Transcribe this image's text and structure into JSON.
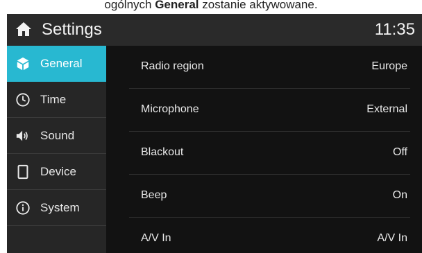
{
  "caption": {
    "prefix": "ogólnych ",
    "bold": "General",
    "suffix": " zostanie aktywowane."
  },
  "header": {
    "title": "Settings",
    "time": "11:35",
    "home_icon": "home-icon"
  },
  "colors": {
    "accent": "#28b8d1",
    "header_bg": "#2a2a2a",
    "sidebar_bg": "#262626",
    "content_bg": "#121212"
  },
  "sidebar": {
    "items": [
      {
        "label": "General",
        "icon": "box-icon",
        "active": true
      },
      {
        "label": "Time",
        "icon": "clock-icon",
        "active": false
      },
      {
        "label": "Sound",
        "icon": "speaker-icon",
        "active": false
      },
      {
        "label": "Device",
        "icon": "device-icon",
        "active": false
      },
      {
        "label": "System",
        "icon": "info-icon",
        "active": false
      }
    ]
  },
  "settings": {
    "rows": [
      {
        "label": "Radio region",
        "value": "Europe"
      },
      {
        "label": "Microphone",
        "value": "External"
      },
      {
        "label": "Blackout",
        "value": "Off"
      },
      {
        "label": "Beep",
        "value": "On"
      },
      {
        "label": "A/V In",
        "value": "A/V In"
      }
    ]
  }
}
